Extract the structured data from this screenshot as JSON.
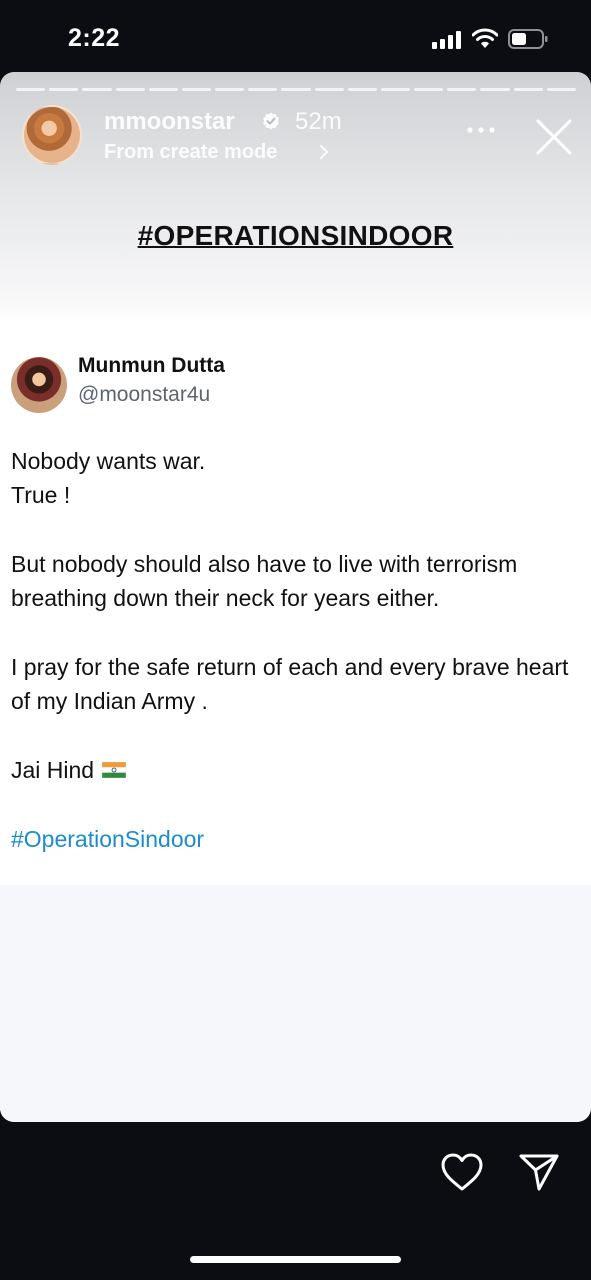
{
  "status_bar": {
    "time": "2:22"
  },
  "story": {
    "progress_segments": 17,
    "username": "mmoonstar",
    "time_ago": "52m",
    "subtitle": "From create mode",
    "title": "#OPERATIONSINDOOR"
  },
  "tweet": {
    "author_name": "Munmun Dutta",
    "author_handle": "@moonstar4u",
    "line1": "Nobody wants war.",
    "line2": "True !",
    "line3": "But nobody should also have to live with terrorism breathing down their neck for years either.",
    "line4": "I pray for the safe return of each and every brave heart of my Indian Army .",
    "line5": "Jai Hind",
    "hashtag": "#OperationSindoor"
  },
  "colors": {
    "background": "#0b0d12",
    "hashtag": "#1d8bd0",
    "handle": "#5b6670"
  },
  "icons": [
    "signal-icon",
    "wifi-icon",
    "battery-icon",
    "verified-icon",
    "chevron-right-icon",
    "more-icon",
    "close-icon",
    "india-flag-icon",
    "heart-icon",
    "send-icon"
  ]
}
